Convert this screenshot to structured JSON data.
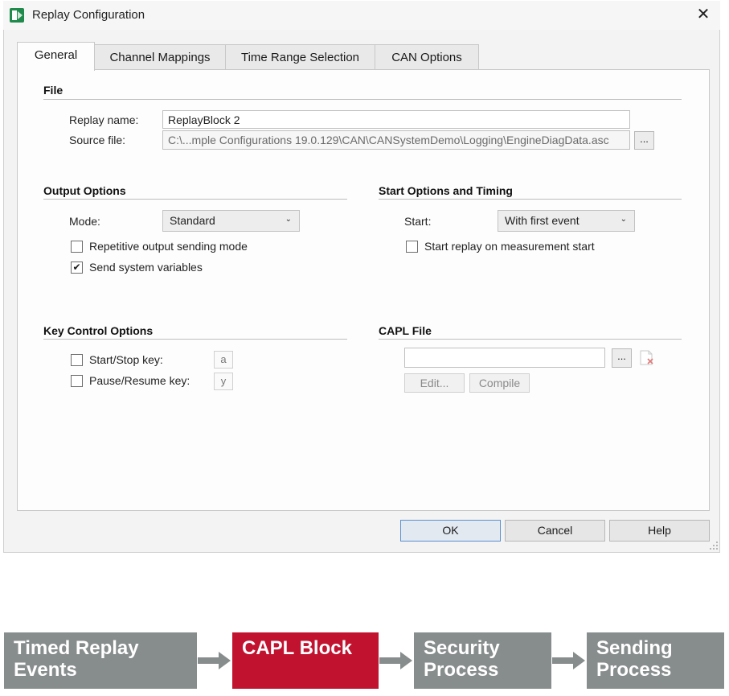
{
  "window": {
    "title": "Replay Configuration",
    "close_glyph": "✕"
  },
  "tabs": [
    {
      "label": "General",
      "active": true
    },
    {
      "label": "Channel Mappings",
      "active": false
    },
    {
      "label": "Time Range Selection",
      "active": false
    },
    {
      "label": "CAN Options",
      "active": false
    }
  ],
  "file_group": {
    "title": "File",
    "replay_name_label": "Replay name:",
    "replay_name_value": "ReplayBlock 2",
    "source_file_label": "Source file:",
    "source_file_value": "C:\\...mple Configurations 19.0.129\\CAN\\CANSystemDemo\\Logging\\EngineDiagData.asc",
    "browse_label": "..."
  },
  "output_options": {
    "title": "Output Options",
    "mode_label": "Mode:",
    "mode_value": "Standard",
    "repetitive_label": "Repetitive output sending mode",
    "repetitive_checked": false,
    "send_sysvars_label": "Send system variables",
    "send_sysvars_checked": true,
    "check_glyph": "✔"
  },
  "start_options": {
    "title": "Start Options and Timing",
    "start_label": "Start:",
    "start_value": "With first event",
    "start_on_measurement_label": "Start replay on measurement start",
    "start_on_measurement_checked": false
  },
  "key_control": {
    "title": "Key Control Options",
    "start_stop_label": "Start/Stop key:",
    "start_stop_key": "a",
    "start_stop_checked": false,
    "pause_resume_label": "Pause/Resume key:",
    "pause_resume_key": "y",
    "pause_resume_checked": false
  },
  "capl_file": {
    "title": "CAPL File",
    "path_value": "",
    "browse_label": "...",
    "edit_label": "Edit...",
    "compile_label": "Compile"
  },
  "buttons": {
    "ok": "OK",
    "cancel": "Cancel",
    "help": "Help"
  },
  "flow": [
    {
      "line1": "Timed Replay",
      "line2": "Events",
      "color": "#878c8d"
    },
    {
      "line1": "CAPL Block",
      "line2": "",
      "color": "#c1122f"
    },
    {
      "line1": "Security",
      "line2": "Process",
      "color": "#878c8d"
    },
    {
      "line1": "Sending",
      "line2": "Process",
      "color": "#878c8d"
    }
  ],
  "colors": {
    "flow_gray": "#878c8d",
    "flow_red": "#c1122f",
    "default_button_border": "#5b8fd0"
  }
}
